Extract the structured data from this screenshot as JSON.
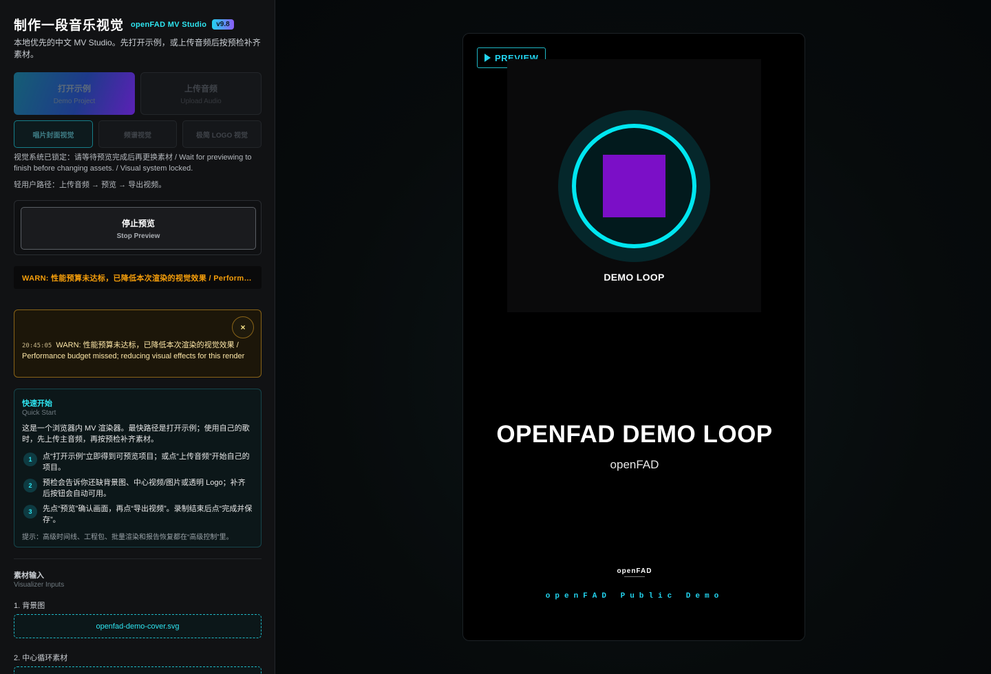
{
  "app": {
    "title": "制作一段音乐视觉",
    "brand": "openFAD MV Studio",
    "version": "v9.8",
    "intro": "本地优先的中文 MV Studio。先打开示例，或上传音频后按预检补齐素材。"
  },
  "actions": {
    "demo": {
      "label": "打开示例",
      "sub": "Demo Project"
    },
    "upload": {
      "label": "上传音频",
      "sub": "Upload Audio"
    }
  },
  "modes": [
    {
      "label": "唱片封面视觉"
    },
    {
      "label": "频谱视觉"
    },
    {
      "label": "极简 LOGO 视觉"
    }
  ],
  "status": {
    "locked": "视觉系统已锁定：请等待预览完成后再更换素材 / Wait for previewing to finish before changing assets. / Visual system locked.",
    "path": "轻用户路径：上传音频 → 预览 → 导出视频。"
  },
  "stop": {
    "label": "停止预览",
    "sub": "Stop Preview"
  },
  "warn_bar": "WARN: 性能预算未达标，已降低本次渲染的视觉效果 / Performance budget missed; reducing visual effects for this render",
  "toast": {
    "close": "×",
    "time": "20:45:05",
    "message": "WARN: 性能预算未达标，已降低本次渲染的视觉效果 / Performance budget missed; reducing visual effects for this render"
  },
  "quick_start": {
    "title": "快速开始",
    "subtitle": "Quick Start",
    "description": "这是一个浏览器内 MV 渲染器。最快路径是打开示例；使用自己的歌时，先上传主音频，再按预检补齐素材。",
    "steps": [
      {
        "num": "1",
        "text": "点“打开示例”立即得到可预览项目；或点“上传音频”开始自己的项目。"
      },
      {
        "num": "2",
        "text": "预检会告诉你还缺背景图、中心视频/图片或透明 Logo；补齐后按钮会自动可用。"
      },
      {
        "num": "3",
        "text": "先点“预览”确认画面，再点“导出视频”。录制结束后点“完成并保存”。"
      }
    ],
    "tip": "提示：高级时间线、工程包、批量渲染和报告恢复都在“高级控制”里。"
  },
  "inputs": {
    "title": "素材输入",
    "subtitle": "Visualizer Inputs",
    "background_label": "1. 背景图",
    "background_file": "openfad-demo-cover.svg",
    "center_label": "2. 中心循环素材"
  },
  "preview": {
    "badge": "PREVIEW",
    "cover_label": "DEMO LOOP",
    "song_title": "OPENFAD DEMO LOOP",
    "artist": "openFAD",
    "logo": "openFAD",
    "footer": "openFAD Public Demo"
  },
  "colors": {
    "accent": "#22d3ee",
    "warn": "#f59e0b",
    "disc_square": "#7b0fc7"
  }
}
